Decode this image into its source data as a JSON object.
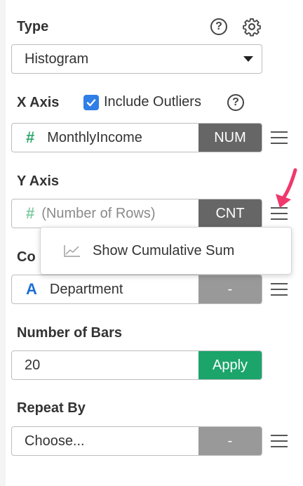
{
  "type_section": {
    "label": "Type",
    "selected": "Histogram"
  },
  "x_axis": {
    "label": "X Axis",
    "include_outliers_label": "Include Outliers",
    "include_outliers_checked": true,
    "column": "MonthlyIncome",
    "column_type_symbol": "#",
    "tag": "NUM"
  },
  "y_axis": {
    "label": "Y Axis",
    "column": "(Number of Rows)",
    "column_type_symbol": "#",
    "tag": "CNT"
  },
  "color": {
    "label_visible": "Co",
    "column": "Department",
    "column_type_symbol": "A",
    "tag": "-"
  },
  "menu_popup": {
    "items": [
      {
        "label": "Show Cumulative Sum",
        "icon": "line-chart-icon"
      }
    ]
  },
  "number_of_bars": {
    "label": "Number of Bars",
    "value": "20",
    "apply_label": "Apply"
  },
  "repeat_by": {
    "label": "Repeat By",
    "value": "Choose...",
    "tag": "-"
  },
  "colors": {
    "accent_green": "#1ba56b",
    "tag_dark": "#666666",
    "tag_gray": "#999999",
    "checkbox_blue": "#2f7fe6",
    "highlight_arrow": "#f0386b",
    "number_type_green": "#2ea76a",
    "string_type_blue": "#1f6fd6"
  }
}
